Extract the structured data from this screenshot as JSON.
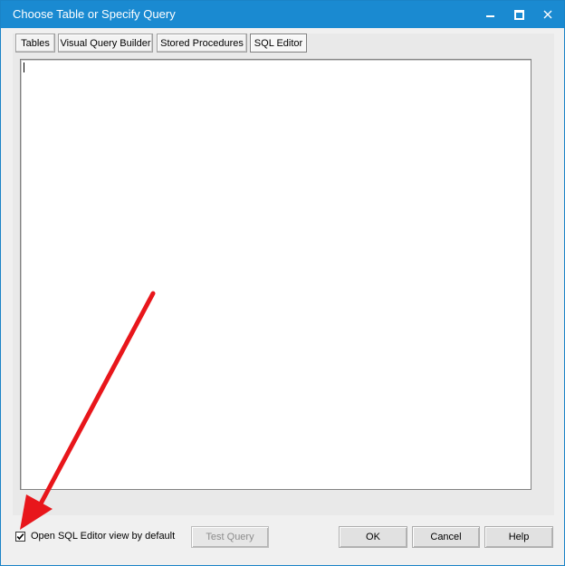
{
  "window": {
    "title": "Choose Table or Specify Query",
    "controls": {
      "minimize_icon": "minimize-icon",
      "maximize_icon": "maximize-icon",
      "close_icon": "close-icon"
    }
  },
  "tabs": [
    {
      "label": "Tables",
      "active": false
    },
    {
      "label": "Visual Query Builder",
      "active": false
    },
    {
      "label": "Stored Procedures",
      "active": false
    },
    {
      "label": "SQL Editor",
      "active": true
    }
  ],
  "editor": {
    "value": ""
  },
  "options": {
    "default_view_label": "Open SQL Editor view by default",
    "default_view_checked": true
  },
  "buttons": {
    "test_query": "Test Query",
    "ok": "OK",
    "cancel": "Cancel",
    "help": "Help"
  },
  "colors": {
    "titlebar": "#1a8ad1",
    "annotation_arrow": "#e8161b"
  }
}
